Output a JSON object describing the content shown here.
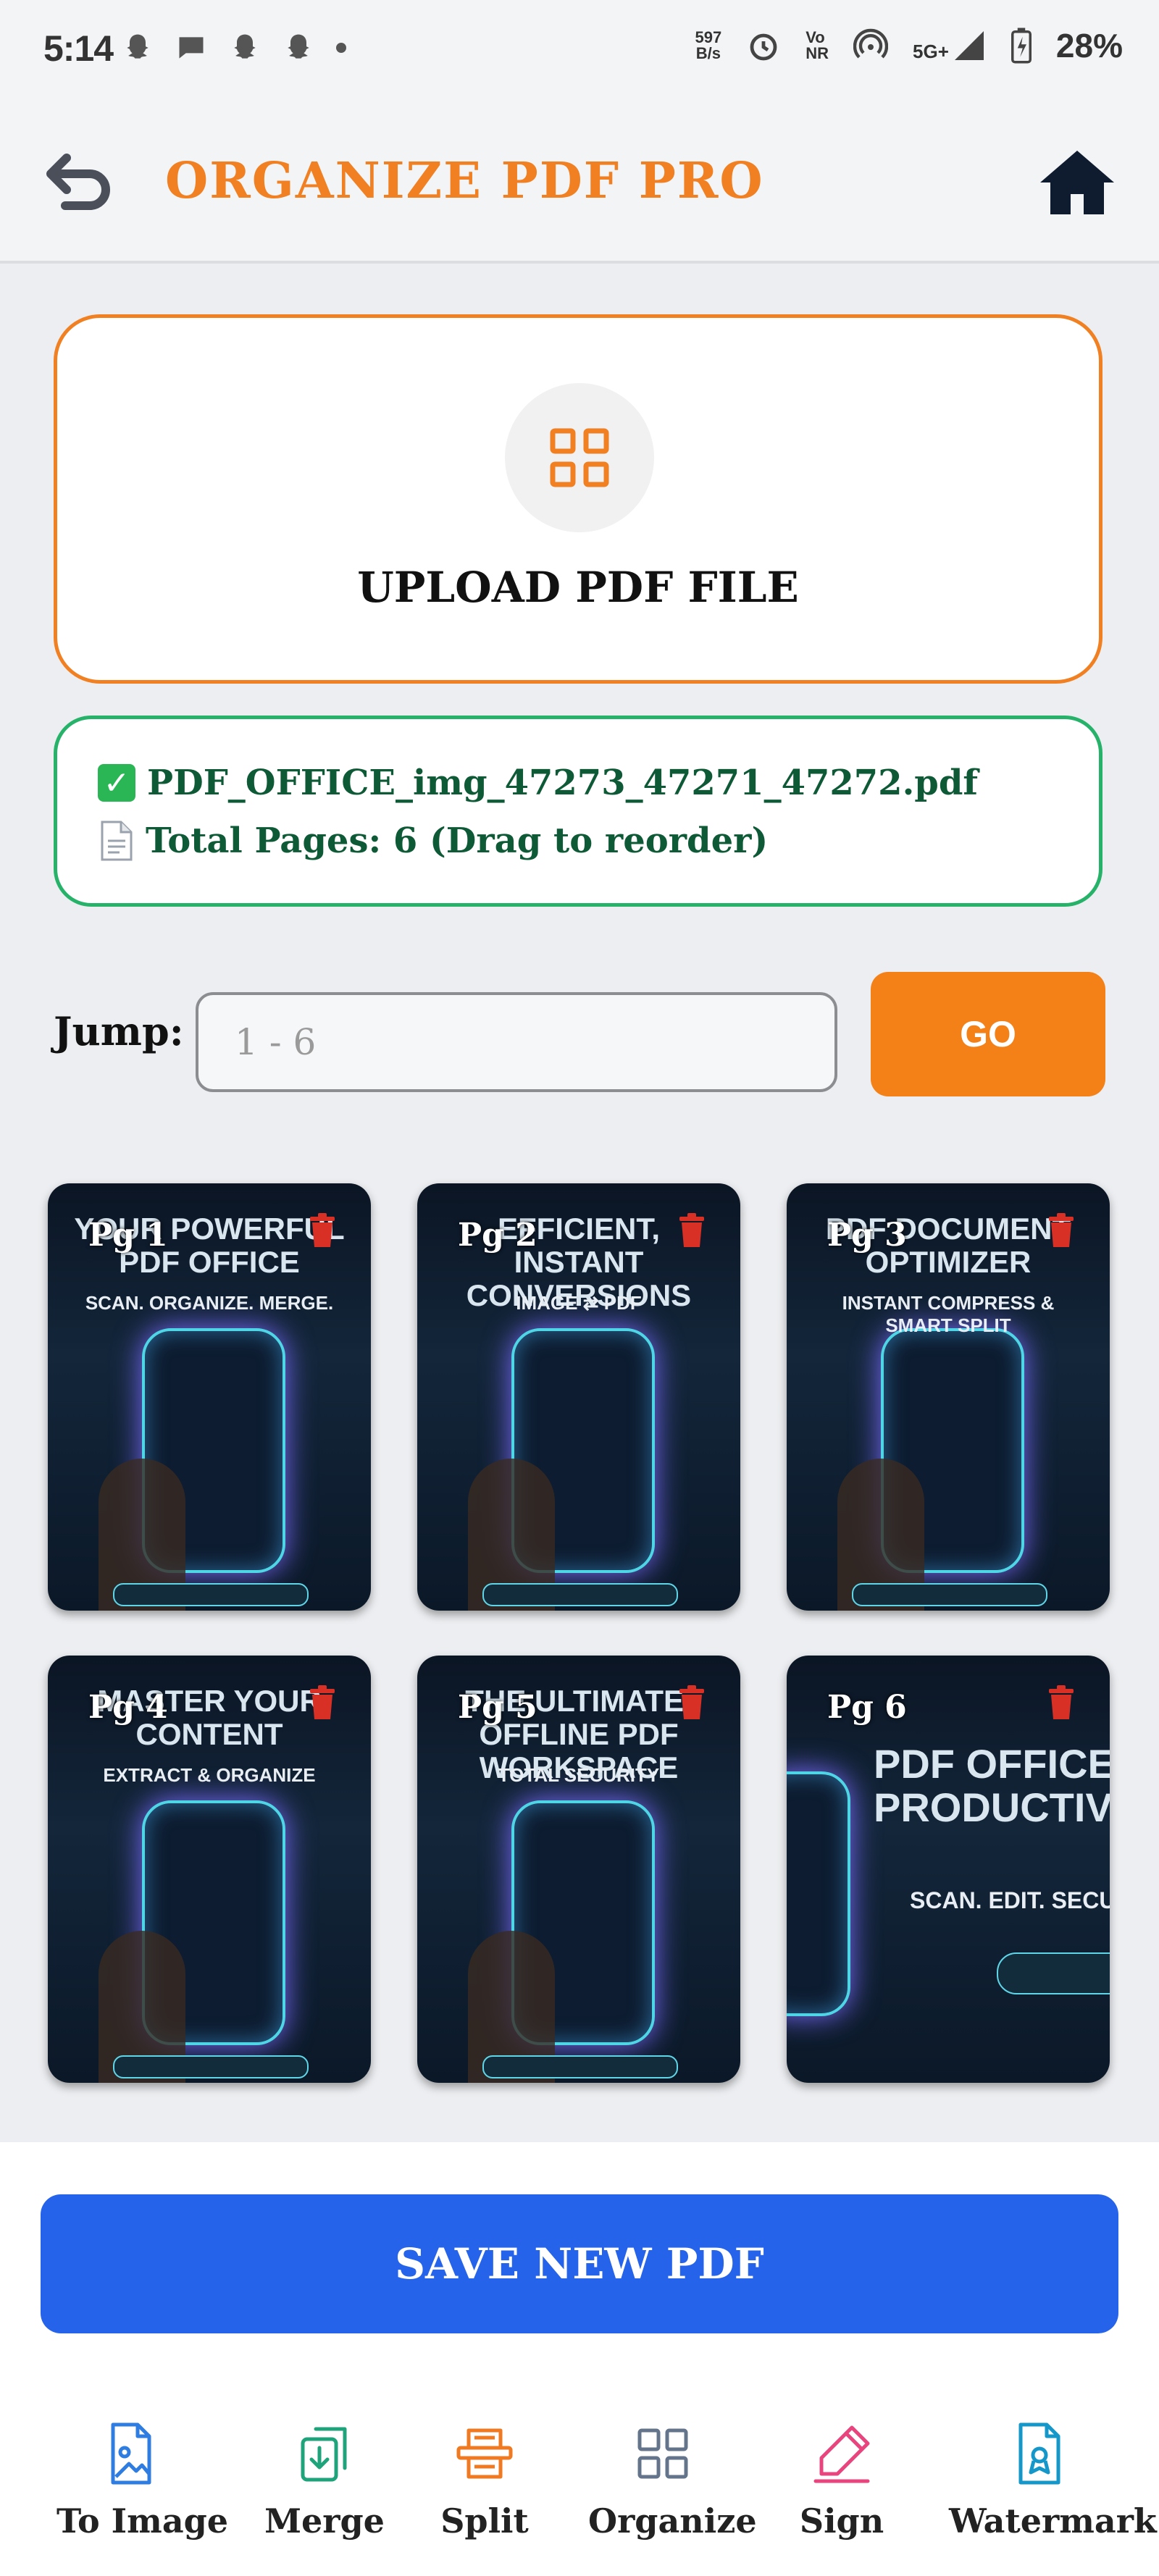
{
  "status_bar": {
    "time": "5:14",
    "net_speed_value": "597",
    "net_speed_unit": "B/s",
    "volte_top": "Vo",
    "volte_bottom": "NR",
    "network": "5G+",
    "battery": "28%"
  },
  "header": {
    "title": "ORGANIZE PDF PRO"
  },
  "upload": {
    "label": "UPLOAD PDF FILE"
  },
  "file_info": {
    "file_name": "PDF_OFFICE_img_47273_47271_47272.pdf",
    "total_pages": "Total Pages: 6 (Drag to reorder)"
  },
  "jump": {
    "label": "Jump:",
    "placeholder": "1 - 6",
    "go_label": "GO"
  },
  "pages": [
    {
      "label": "Pg 1",
      "headline": "YOUR POWERFUL PDF OFFICE",
      "subline": "SCAN. ORGANIZE. MERGE."
    },
    {
      "label": "Pg 2",
      "headline": "EFFICIENT, INSTANT CONVERSIONS",
      "subline": "IMAGE ⇄ PDF"
    },
    {
      "label": "Pg 3",
      "headline": "PDF DOCUMENT OPTIMIZER",
      "subline": "INSTANT COMPRESS & SMART SPLIT"
    },
    {
      "label": "Pg 4",
      "headline": "MASTER YOUR CONTENT",
      "subline": "EXTRACT & ORGANIZE"
    },
    {
      "label": "Pg 5",
      "headline": "THE ULTIMATE, OFFLINE PDF WORKSPACE",
      "subline": "TOTAL SECURITY"
    },
    {
      "label": "Pg 6",
      "headline": "PDF OFFICE - PRODUCTIVIT",
      "subline": "SCAN. EDIT. SECURE"
    }
  ],
  "save": {
    "label": "SAVE NEW PDF"
  },
  "bottom_nav": [
    {
      "label": "To Image",
      "color": "#2f7de1"
    },
    {
      "label": "Merge",
      "color": "#1fa37a"
    },
    {
      "label": "Split",
      "color": "#f07a22"
    },
    {
      "label": "Organize",
      "color": "#64748b"
    },
    {
      "label": "Sign",
      "color": "#e8457f"
    },
    {
      "label": "Watermark",
      "color": "#1597c9"
    }
  ],
  "colors": {
    "accent": "#f08022",
    "success": "#26b269",
    "primary": "#2563eb"
  }
}
